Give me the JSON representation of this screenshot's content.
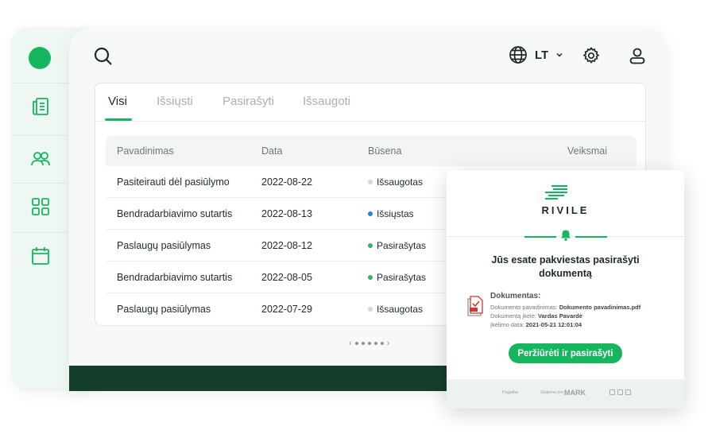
{
  "language": {
    "code": "LT"
  },
  "tabs": [
    {
      "label": "Visi",
      "active": true
    },
    {
      "label": "Išsiųsti",
      "active": false
    },
    {
      "label": "Pasirašyti",
      "active": false
    },
    {
      "label": "Išsaugoti",
      "active": false
    }
  ],
  "table": {
    "columns": {
      "name": "Pavadinimas",
      "date": "Data",
      "status": "Būsena",
      "actions": "Veiksmai"
    },
    "rows": [
      {
        "name": "Pasiteirauti dėl pasiūlymo",
        "date": "2022-08-22",
        "status": "Išsaugotas",
        "status_color": "#d3d7d5"
      },
      {
        "name": "Bendradarbiavimo sutartis",
        "date": "2022-08-13",
        "status": "Išsiųstas",
        "status_color": "#1a8fc9"
      },
      {
        "name": "Paslaugų pasiūlymas",
        "date": "2022-08-12",
        "status": "Pasirašytas",
        "status_color": "#2fb56b"
      },
      {
        "name": "Bendradarbiavimo sutartis",
        "date": "2022-08-05",
        "status": "Pasirašytas",
        "status_color": "#2fb56b"
      },
      {
        "name": "Paslaugų pasiūlymas",
        "date": "2022-07-29",
        "status": "Išsaugotas",
        "status_color": "#d3d7d5"
      }
    ]
  },
  "pager": {
    "prev": "‹",
    "next": "›"
  },
  "email": {
    "brand": "RIVILE",
    "title": "Jūs esate pakviestas pasirašyti dokumentą",
    "doc_heading": "Dokumentas:",
    "doc_name_label": "Dokumento pavadinimas:",
    "doc_name_value": "Dokumento pavadinimas.pdf",
    "uploaded_by_label": "Dokumentą įkėlė:",
    "uploaded_by_value": "Vardas Pavardė",
    "upload_date_label": "Įkėlimo data:",
    "upload_date_value": "2021-05-21 12:01:04",
    "button_label": "Peržiūrėti ir pasirašyti",
    "footer_help": "Pagalba",
    "footer_signed_by": "Sistema per",
    "footer_logo": "MARK"
  },
  "colors": {
    "accent": "#15b65f",
    "dark_band": "#133f2c"
  },
  "icons": [
    "search-icon",
    "globe-icon",
    "chevron-down-icon",
    "gear-icon",
    "user-icon",
    "documents-icon",
    "users-icon",
    "grid-icon",
    "calendar-icon",
    "bell-icon",
    "pdf-icon"
  ]
}
